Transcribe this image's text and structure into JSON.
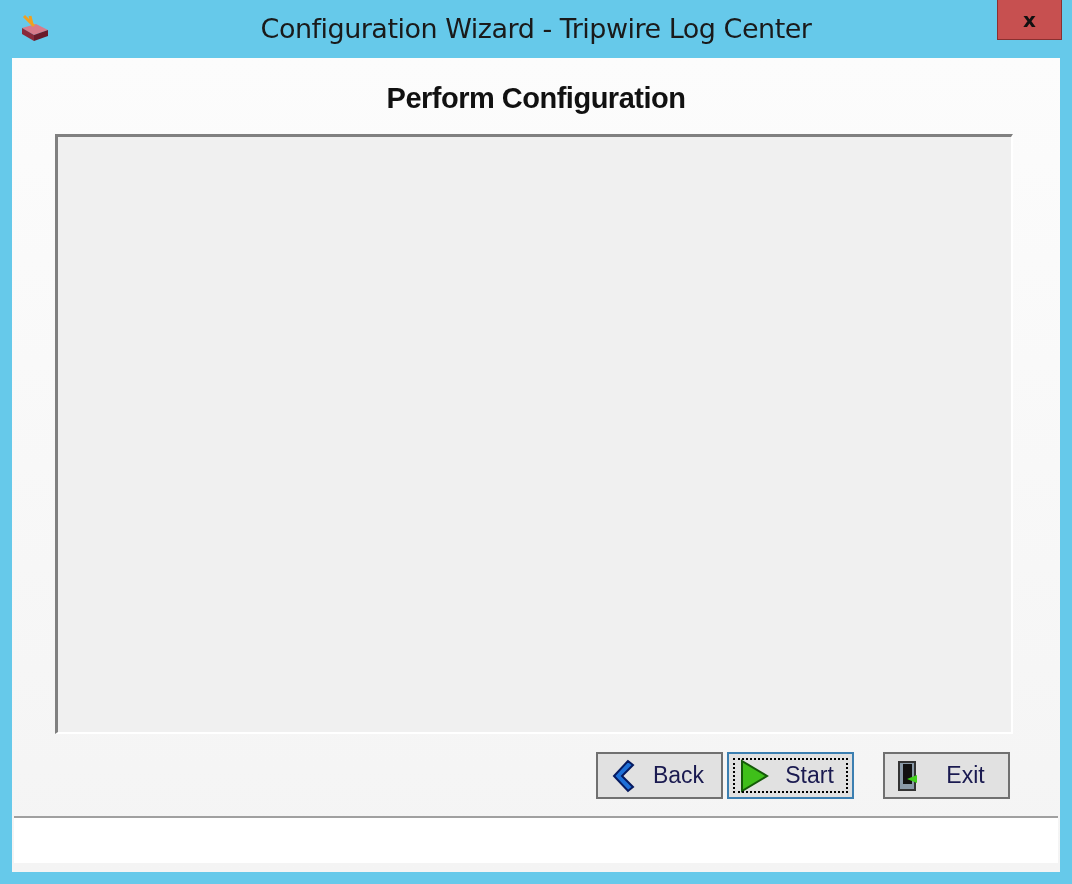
{
  "window": {
    "title": "Configuration Wizard - Tripwire Log Center",
    "close": "x"
  },
  "heading": "Perform Configuration",
  "buttons": [
    {
      "kind": "back",
      "label": "Back",
      "focused": false
    },
    {
      "kind": "start",
      "label": "Start",
      "focused": true
    },
    {
      "kind": "exit",
      "label": "Exit",
      "focused": false
    }
  ]
}
